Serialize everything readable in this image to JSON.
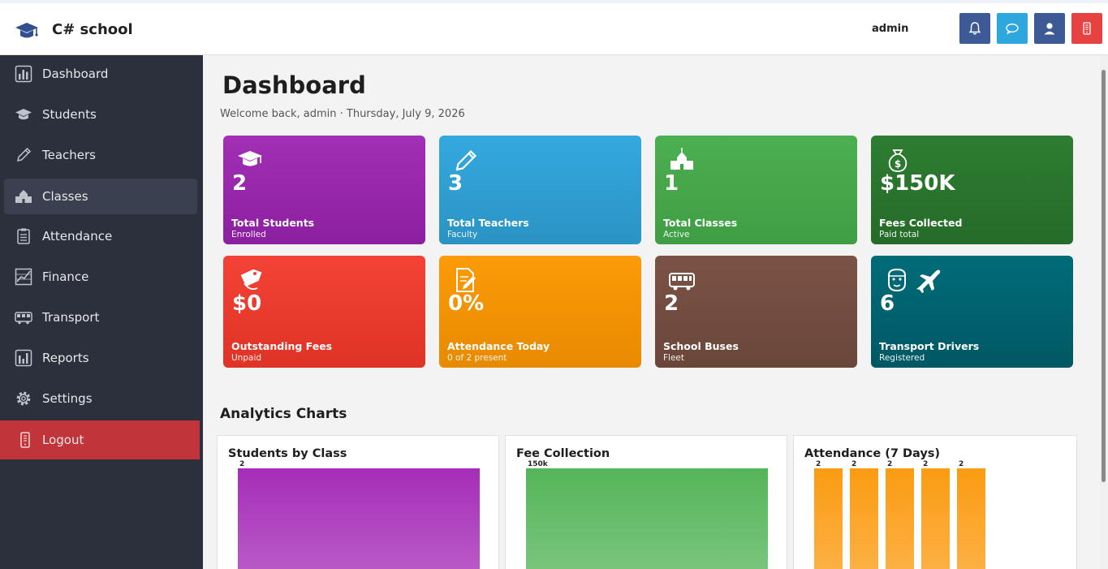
{
  "header": {
    "app_title": "C# school",
    "user": "admin",
    "buttons": [
      {
        "name": "notifications",
        "color": "#3d5a96"
      },
      {
        "name": "messages",
        "color": "#2ea6de"
      },
      {
        "name": "profile",
        "color": "#3d5a96"
      },
      {
        "name": "mobile",
        "color": "#e64242"
      }
    ]
  },
  "sidebar": {
    "items": [
      {
        "label": "Dashboard",
        "icon": "bar-chart-icon"
      },
      {
        "label": "Students",
        "icon": "graduation-cap-icon"
      },
      {
        "label": "Teachers",
        "icon": "pencil-icon"
      },
      {
        "label": "Classes",
        "icon": "school-icon",
        "active": true
      },
      {
        "label": "Attendance",
        "icon": "clipboard-icon"
      },
      {
        "label": "Finance",
        "icon": "finance-chart-icon"
      },
      {
        "label": "Transport",
        "icon": "bus-icon"
      },
      {
        "label": "Reports",
        "icon": "reports-chart-icon"
      },
      {
        "label": "Settings",
        "icon": "gear-icon"
      },
      {
        "label": "Logout",
        "icon": "logout-icon"
      }
    ]
  },
  "main": {
    "title": "Dashboard",
    "welcome": "Welcome back, admin  ·  Thursday, July 9, 2026",
    "cards": [
      {
        "value": "2",
        "label": "Total Students",
        "sub": "Enrolled",
        "icon": "graduation-cap-icon",
        "colors": [
          "#a22fb5",
          "#8c1fa0"
        ]
      },
      {
        "value": "3",
        "label": "Total Teachers",
        "sub": "Faculty",
        "icon": "pencil-icon",
        "colors": [
          "#34a9df",
          "#2b93c4"
        ]
      },
      {
        "value": "1",
        "label": "Total Classes",
        "sub": "Active",
        "icon": "school-icon",
        "colors": [
          "#4caf50",
          "#3f9e44"
        ]
      },
      {
        "value": "$150K",
        "label": "Fees Collected",
        "sub": "Paid total",
        "icon": "money-bag-icon",
        "colors": [
          "#2e7d32",
          "#256b29"
        ]
      },
      {
        "value": "$0",
        "label": "Outstanding Fees",
        "sub": "Unpaid",
        "icon": "price-tag-icon",
        "colors": [
          "#f44336",
          "#de3326"
        ]
      },
      {
        "value": "0%",
        "label": "Attendance Today",
        "sub": "0 of 2 present",
        "icon": "edit-document-icon",
        "colors": [
          "#fb9b08",
          "#e88a00"
        ]
      },
      {
        "value": "2",
        "label": "School Buses",
        "sub": "Fleet",
        "icon": "bus-icon",
        "colors": [
          "#7b5346",
          "#6a463a"
        ]
      },
      {
        "value": "6",
        "label": "Transport Drivers",
        "sub": "Registered",
        "icon": "driver-plane-icon",
        "colors": [
          "#006c78",
          "#005864"
        ]
      }
    ],
    "analytics_title": "Analytics Charts",
    "charts": [
      {
        "title": "Students by Class"
      },
      {
        "title": "Fee Collection"
      },
      {
        "title": "Attendance (7 Days)"
      }
    ]
  },
  "chart_data": [
    {
      "type": "bar",
      "title": "Students by Class",
      "values": [
        2
      ],
      "labels": [
        "2"
      ],
      "color": "#a62db8"
    },
    {
      "type": "bar",
      "title": "Fee Collection",
      "values": [
        150000
      ],
      "labels": [
        "150k"
      ],
      "color": "#55b559"
    },
    {
      "type": "bar",
      "title": "Attendance (7 Days)",
      "values": [
        2,
        2,
        2,
        2,
        2
      ],
      "labels": [
        "2",
        "2",
        "2",
        "2",
        "2"
      ],
      "color": "#fb9b12"
    }
  ]
}
